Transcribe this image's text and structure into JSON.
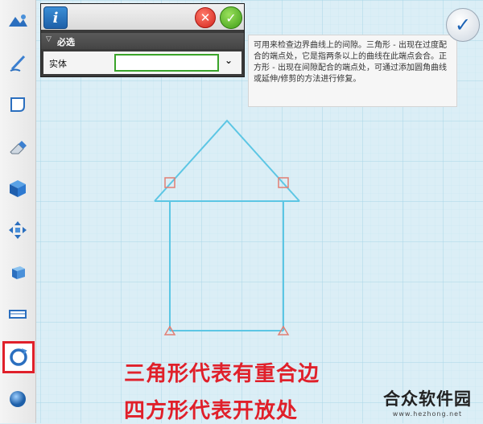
{
  "panel": {
    "section_label": "必选",
    "field_label": "实体",
    "field_value": "",
    "info_icon": "info-icon",
    "cancel_icon": "cancel-icon",
    "ok_icon": "check-icon"
  },
  "tooltip": {
    "text": "可用来检查边界曲线上的间隙。三角形 - 出现在过度配合的端点处，它是指两条以上的曲线在此端点会合。正方形 - 出现在间隙配合的端点处，可通过添加圆角曲线或延伸/修剪的方法进行修复。"
  },
  "toolbar": {
    "items": [
      "basic-shapes-icon",
      "sketch-pen-icon",
      "sketch-rectangle-icon",
      "eraser-icon",
      "solid-cube-icon",
      "move-arrows-icon",
      "combine-box-icon",
      "measure-ruler-icon",
      "inspect-loop-icon",
      "sphere-icon"
    ],
    "selected_index": 8
  },
  "captions": {
    "line1": "三角形代表有重合边",
    "line2": "四方形代表开放处"
  },
  "watermark": {
    "title": "合众软件园",
    "url": "www.hezhong.net"
  },
  "colors": {
    "canvas": "#dbeef6",
    "grid": "#b5dceb",
    "sketch": "#5cc6e4",
    "marker": "#e27f74",
    "caption": "#e0202a"
  }
}
